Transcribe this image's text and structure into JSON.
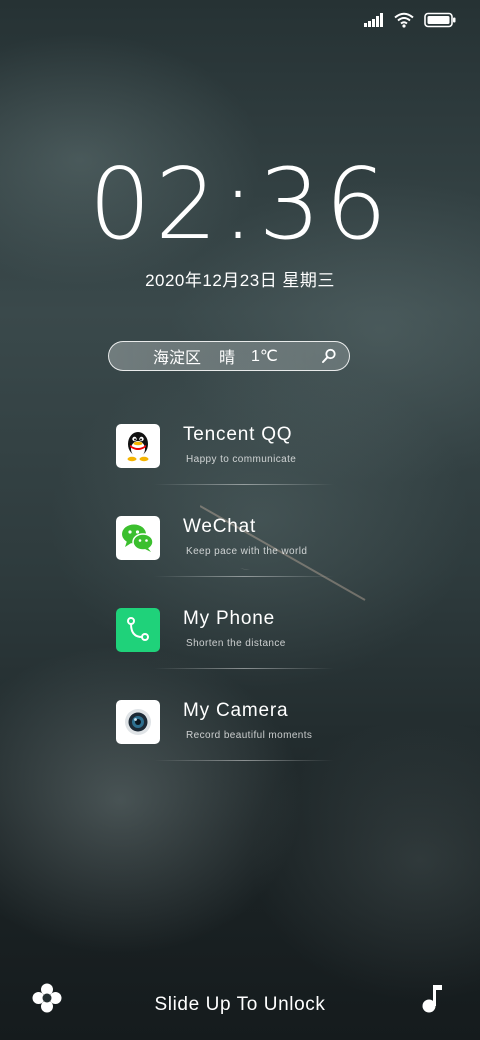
{
  "status_bar": {
    "icons": [
      "signal-icon",
      "wifi-icon",
      "battery-icon"
    ]
  },
  "clock": {
    "time": "02:36",
    "date": "2020年12月23日 星期三"
  },
  "weather": {
    "location": "海淀区",
    "condition": "晴",
    "temperature": "1℃",
    "icon": "search-icon"
  },
  "apps": [
    {
      "name": "Tencent QQ",
      "description": "Happy to communicate",
      "icon": "qq-icon"
    },
    {
      "name": "WeChat",
      "description": "Keep pace with the world",
      "icon": "wechat-icon"
    },
    {
      "name": "My Phone",
      "description": "Shorten the distance",
      "icon": "phone-icon",
      "icon_color": "#1fd27a"
    },
    {
      "name": "My Camera",
      "description": "Record beautiful moments",
      "icon": "camera-icon"
    }
  ],
  "bottom": {
    "unlock_text": "Slide Up To Unlock",
    "left_icon": "settings-flower-icon",
    "right_icon": "music-note-icon"
  }
}
